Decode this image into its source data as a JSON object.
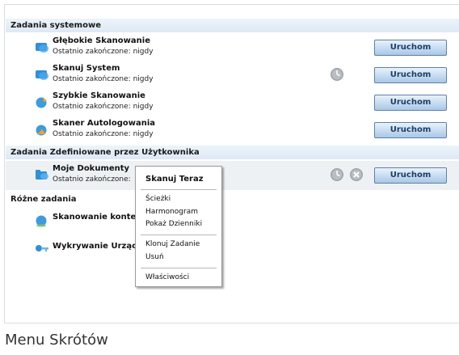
{
  "sections": {
    "system": "Zadania systemowe",
    "user": "Zadania Zdefiniowane przez Użytkownika",
    "other": "Różne zadania"
  },
  "system_tasks": [
    {
      "name": "Głębokie Skanowanie",
      "status": "Ostatnio zakończone: nigdy",
      "button": "Uruchom"
    },
    {
      "name": "Skanuj System",
      "status": "Ostatnio zakończone: nigdy",
      "button": "Uruchom"
    },
    {
      "name": "Szybkie Skanowanie",
      "status": "Ostatnio zakończone: nigdy",
      "button": "Uruchom"
    },
    {
      "name": "Skaner Autologowania",
      "status": "Ostatnio zakończone: nigdy",
      "button": "Uruchom"
    }
  ],
  "user_tasks": [
    {
      "name": "Moje Dokumenty",
      "status": "Ostatnio zakończone:",
      "button": "Uruchom"
    }
  ],
  "other_tasks": [
    {
      "name": "Skanowanie konte"
    },
    {
      "name": "Wykrywanie Urząc"
    }
  ],
  "context_menu": {
    "default_item": "Skanuj Teraz",
    "group1": [
      "Ścieżki",
      "Harmonogram",
      "Pokaż Dzienniki"
    ],
    "group2": [
      "Klonuj Zadanie",
      "Usuń"
    ],
    "group3": [
      "Właściwości"
    ]
  },
  "caption": "Menu Skrótów",
  "colors": {
    "section_header_bg": "#dde9f5",
    "button_text": "#1d3f67",
    "button_border": "#5d82a8"
  }
}
